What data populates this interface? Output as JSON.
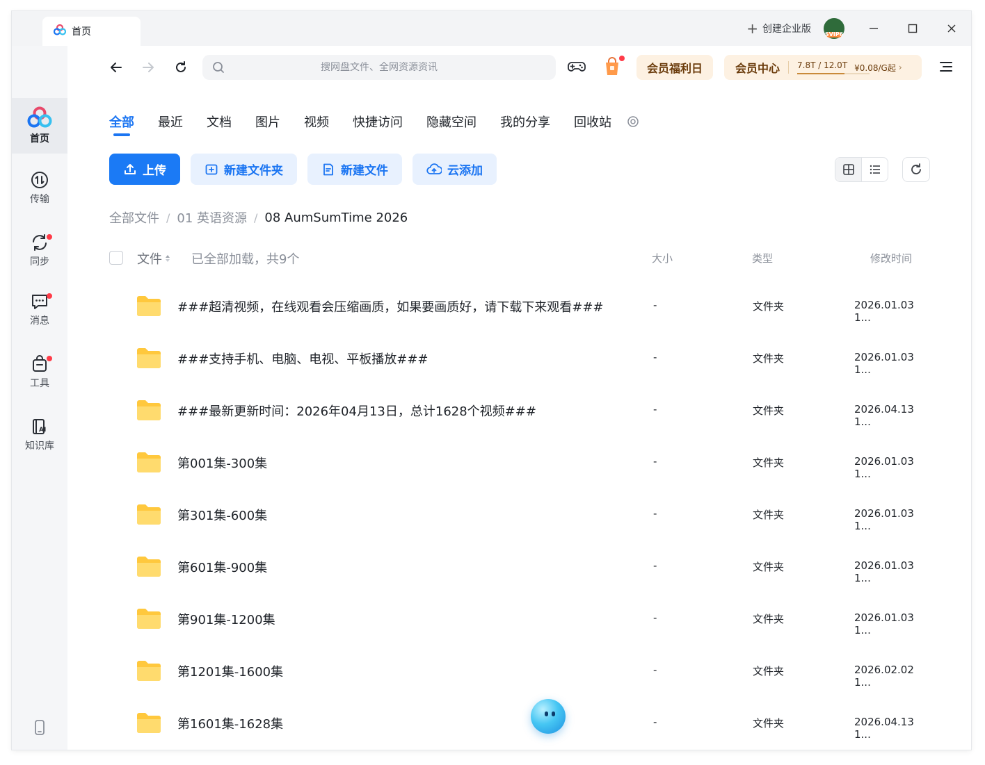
{
  "colors": {
    "accent": "#1b75f2",
    "badge": "#ff3b48",
    "folder": "#ffc83d",
    "vip_text": "#6b3c0c"
  },
  "titlebar": {
    "tab_label": "首页",
    "create_enterprise": "创建企业版",
    "avatar_text": "SVIP6"
  },
  "sidebar": {
    "items": [
      {
        "label": "首页",
        "icon": "home-logo-icon"
      },
      {
        "label": "传输",
        "icon": "transfer-icon"
      },
      {
        "label": "同步",
        "icon": "sync-icon"
      },
      {
        "label": "消息",
        "icon": "message-icon"
      },
      {
        "label": "工具",
        "icon": "tools-icon"
      },
      {
        "label": "知识库",
        "icon": "knowledge-base-icon"
      }
    ]
  },
  "toolbar": {
    "search_placeholder": "搜网盘文件、全网资源资讯",
    "welfare_day": "会员福利日",
    "vip_center": "会员中心",
    "storage": "7.8T / 12.0T",
    "storage_used_fraction": 0.65,
    "price": "¥0.08/G起"
  },
  "tabs": [
    "全部",
    "最近",
    "文档",
    "图片",
    "视频",
    "快捷访问",
    "隐藏空间",
    "我的分享",
    "回收站"
  ],
  "actions": {
    "upload": "上传",
    "new_folder": "新建文件夹",
    "new_file": "新建文件",
    "cloud_add": "云添加"
  },
  "breadcrumb": [
    "全部文件",
    "01 英语资源",
    "08 AumSumTime 2026"
  ],
  "list_header": {
    "file": "文件",
    "loaded": "已全部加载，共9个",
    "size": "大小",
    "type": "类型",
    "modified": "修改时间"
  },
  "files": [
    {
      "name": "###超清视频，在线观看会压缩画质，如果要画质好，请下载下来观看###",
      "size": "-",
      "type": "文件夹",
      "modified": "2026.01.03 1..."
    },
    {
      "name": "###支持手机、电脑、电视、平板播放###",
      "size": "-",
      "type": "文件夹",
      "modified": "2026.01.03 1..."
    },
    {
      "name": "###最新更新时间：2026年04月13日，总计1628个视频###",
      "size": "-",
      "type": "文件夹",
      "modified": "2026.04.13 1..."
    },
    {
      "name": "第001集-300集",
      "size": "-",
      "type": "文件夹",
      "modified": "2026.01.03 1..."
    },
    {
      "name": "第301集-600集",
      "size": "-",
      "type": "文件夹",
      "modified": "2026.01.03 1..."
    },
    {
      "name": "第601集-900集",
      "size": "-",
      "type": "文件夹",
      "modified": "2026.01.03 1..."
    },
    {
      "name": "第901集-1200集",
      "size": "-",
      "type": "文件夹",
      "modified": "2026.01.03 1..."
    },
    {
      "name": "第1201集-1600集",
      "size": "-",
      "type": "文件夹",
      "modified": "2026.02.02 1..."
    },
    {
      "name": "第1601集-1628集",
      "size": "-",
      "type": "文件夹",
      "modified": "2026.04.13 1..."
    }
  ]
}
